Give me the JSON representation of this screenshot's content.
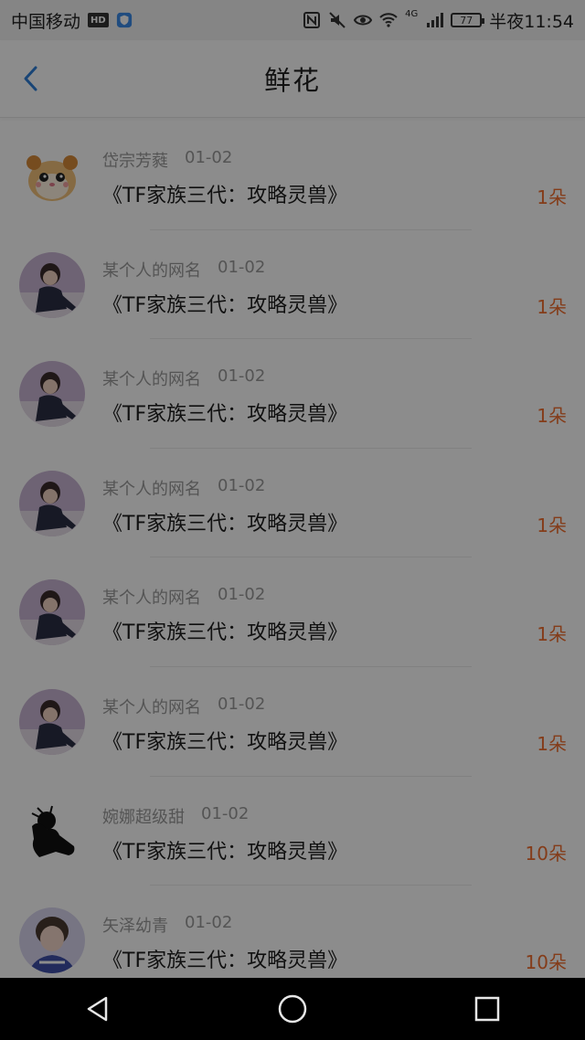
{
  "status_bar": {
    "carrier": "中国移动",
    "hd": "HD",
    "signal": "4G",
    "battery": "77",
    "time": "半夜11:54"
  },
  "header": {
    "title": "鲜花"
  },
  "list": [
    {
      "name": "岱宗芳蕤",
      "date": "01-02",
      "title": "《TF家族三代：攻略灵兽》",
      "count": "1朵",
      "avatar": "hamster-avatar"
    },
    {
      "name": "某个人的网名",
      "date": "01-02",
      "title": "《TF家族三代：攻略灵兽》",
      "count": "1朵",
      "avatar": "person-avatar"
    },
    {
      "name": "某个人的网名",
      "date": "01-02",
      "title": "《TF家族三代：攻略灵兽》",
      "count": "1朵",
      "avatar": "person-avatar"
    },
    {
      "name": "某个人的网名",
      "date": "01-02",
      "title": "《TF家族三代：攻略灵兽》",
      "count": "1朵",
      "avatar": "person-avatar"
    },
    {
      "name": "某个人的网名",
      "date": "01-02",
      "title": "《TF家族三代：攻略灵兽》",
      "count": "1朵",
      "avatar": "person-avatar"
    },
    {
      "name": "某个人的网名",
      "date": "01-02",
      "title": "《TF家族三代：攻略灵兽》",
      "count": "1朵",
      "avatar": "person-avatar"
    },
    {
      "name": "婉娜超级甜",
      "date": "01-02",
      "title": "《TF家族三代：攻略灵兽》",
      "count": "10朵",
      "avatar": "silhouette-avatar"
    },
    {
      "name": "矢泽幼青",
      "date": "01-02",
      "title": "《TF家族三代：攻略灵兽》",
      "count": "10朵",
      "avatar": "boy-avatar"
    }
  ],
  "colors": {
    "accent": "#f06e2f",
    "back_arrow": "#2f7fd8",
    "overlay": "rgba(0,0,0,0.45)"
  }
}
